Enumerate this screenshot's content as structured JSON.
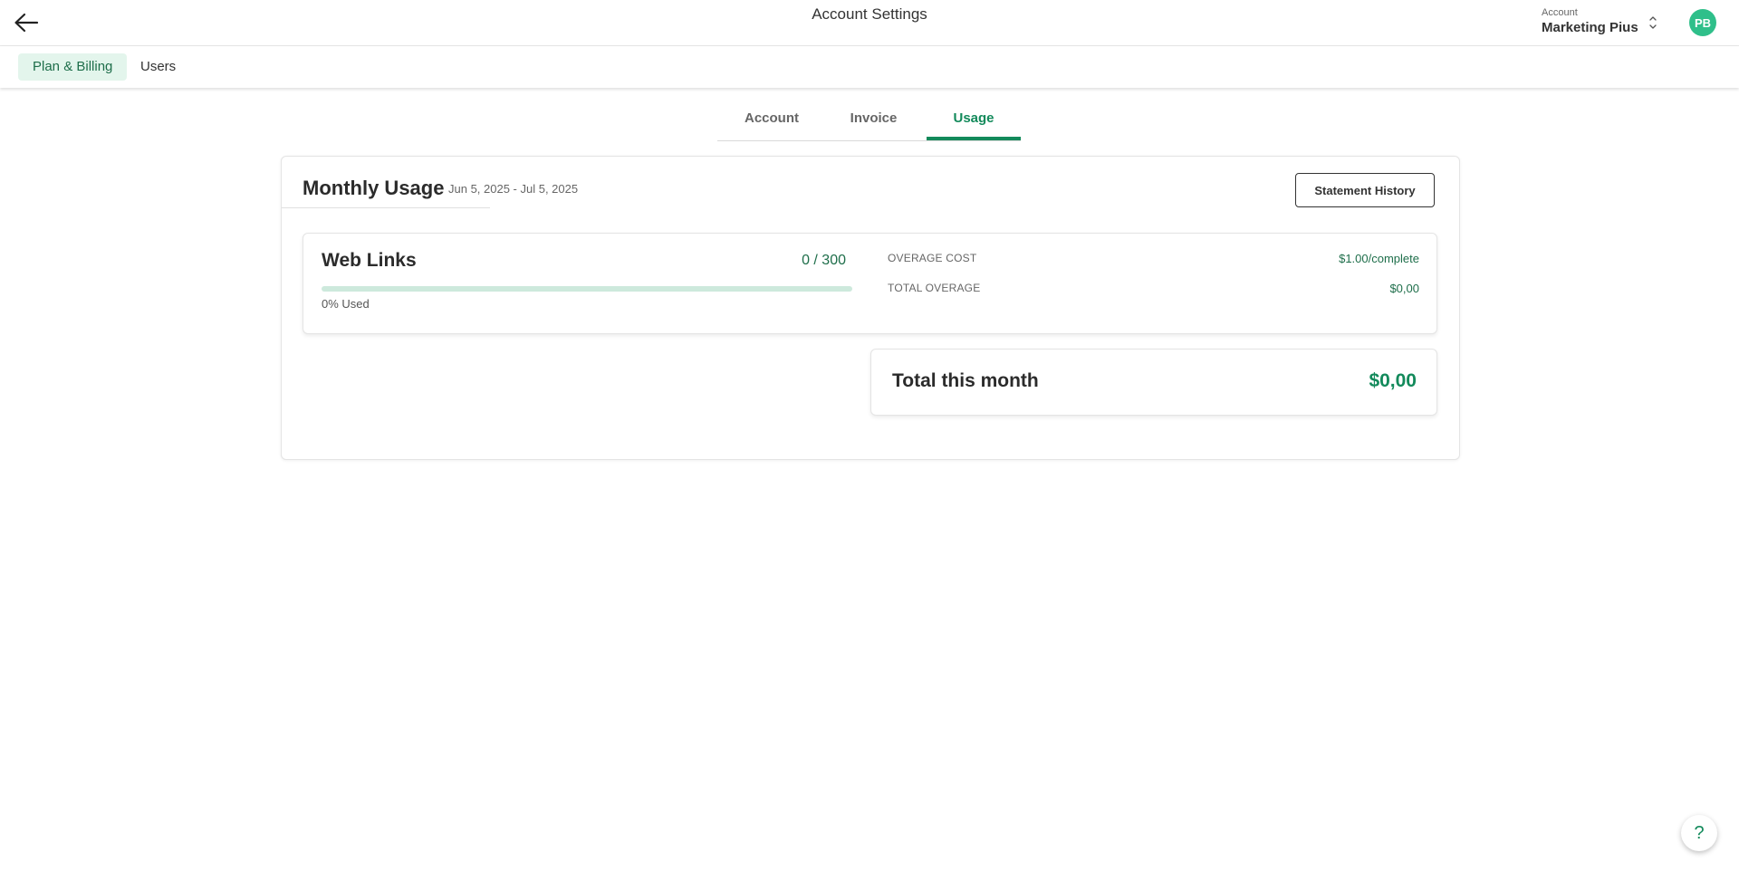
{
  "header": {
    "title": "Account Settings",
    "account_label": "Account",
    "account_name": "Marketing Pius",
    "avatar_initials": "PB",
    "back_icon": "arrow-left-icon",
    "switch_icon": "chevron-updown-icon"
  },
  "subnav": {
    "items": [
      {
        "label": "Plan & Billing",
        "active": true
      },
      {
        "label": "Users",
        "active": false
      }
    ]
  },
  "tabs": [
    {
      "label": "Account",
      "active": false
    },
    {
      "label": "Invoice",
      "active": false
    },
    {
      "label": "Usage",
      "active": true
    }
  ],
  "usage": {
    "title": "Monthly Usage",
    "date_range": "Jun 5, 2025 - Jul 5, 2025",
    "statement_button": "Statement History",
    "items": [
      {
        "name": "Web Links",
        "count": "0 / 300",
        "progress": 0,
        "used_text": "0% Used",
        "overage_cost_label": "OVERAGE COST",
        "overage_cost_value": "$1.00/complete",
        "total_overage_label": "TOTAL OVERAGE",
        "total_overage_value": "$0,00"
      }
    ],
    "total_label": "Total this month",
    "total_value": "$0,00"
  },
  "help": {
    "icon": "question-mark-icon",
    "glyph": "?"
  },
  "colors": {
    "accent": "#138a5b",
    "accent_light": "#e3f5ec",
    "avatar_bg": "#2fbf8a",
    "progress_track": "#cde9dc"
  }
}
